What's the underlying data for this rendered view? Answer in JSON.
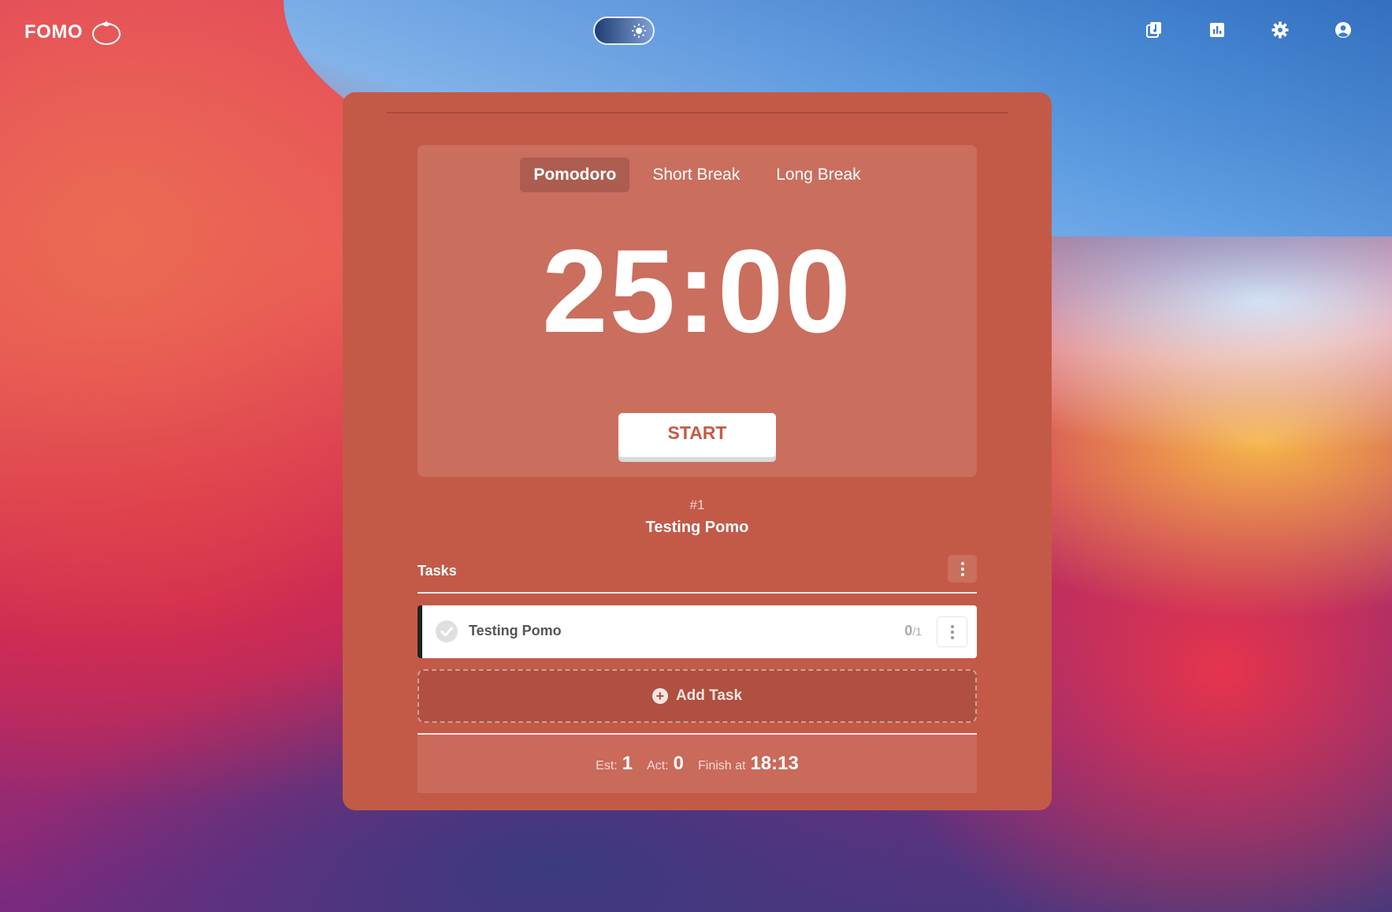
{
  "header": {
    "brand": "FOMO",
    "nav": [
      "music-icon",
      "stats-icon",
      "settings-icon",
      "account-icon"
    ]
  },
  "timer": {
    "modes": [
      "Pomodoro",
      "Short Break",
      "Long Break"
    ],
    "active_mode": "Pomodoro",
    "time": "25:00",
    "start_label": "START"
  },
  "current": {
    "counter": "#1",
    "task": "Testing Pomo"
  },
  "tasks": {
    "title": "Tasks",
    "items": [
      {
        "name": "Testing Pomo",
        "done": "0",
        "est": "/1"
      }
    ],
    "add_label": "Add Task"
  },
  "summary": {
    "est_label": "Est:",
    "est_value": "1",
    "act_label": "Act:",
    "act_value": "0",
    "finish_label": "Finish at",
    "finish_value": "18:13"
  },
  "colors": {
    "card": "#c35a48",
    "accent": "#c35a48"
  }
}
